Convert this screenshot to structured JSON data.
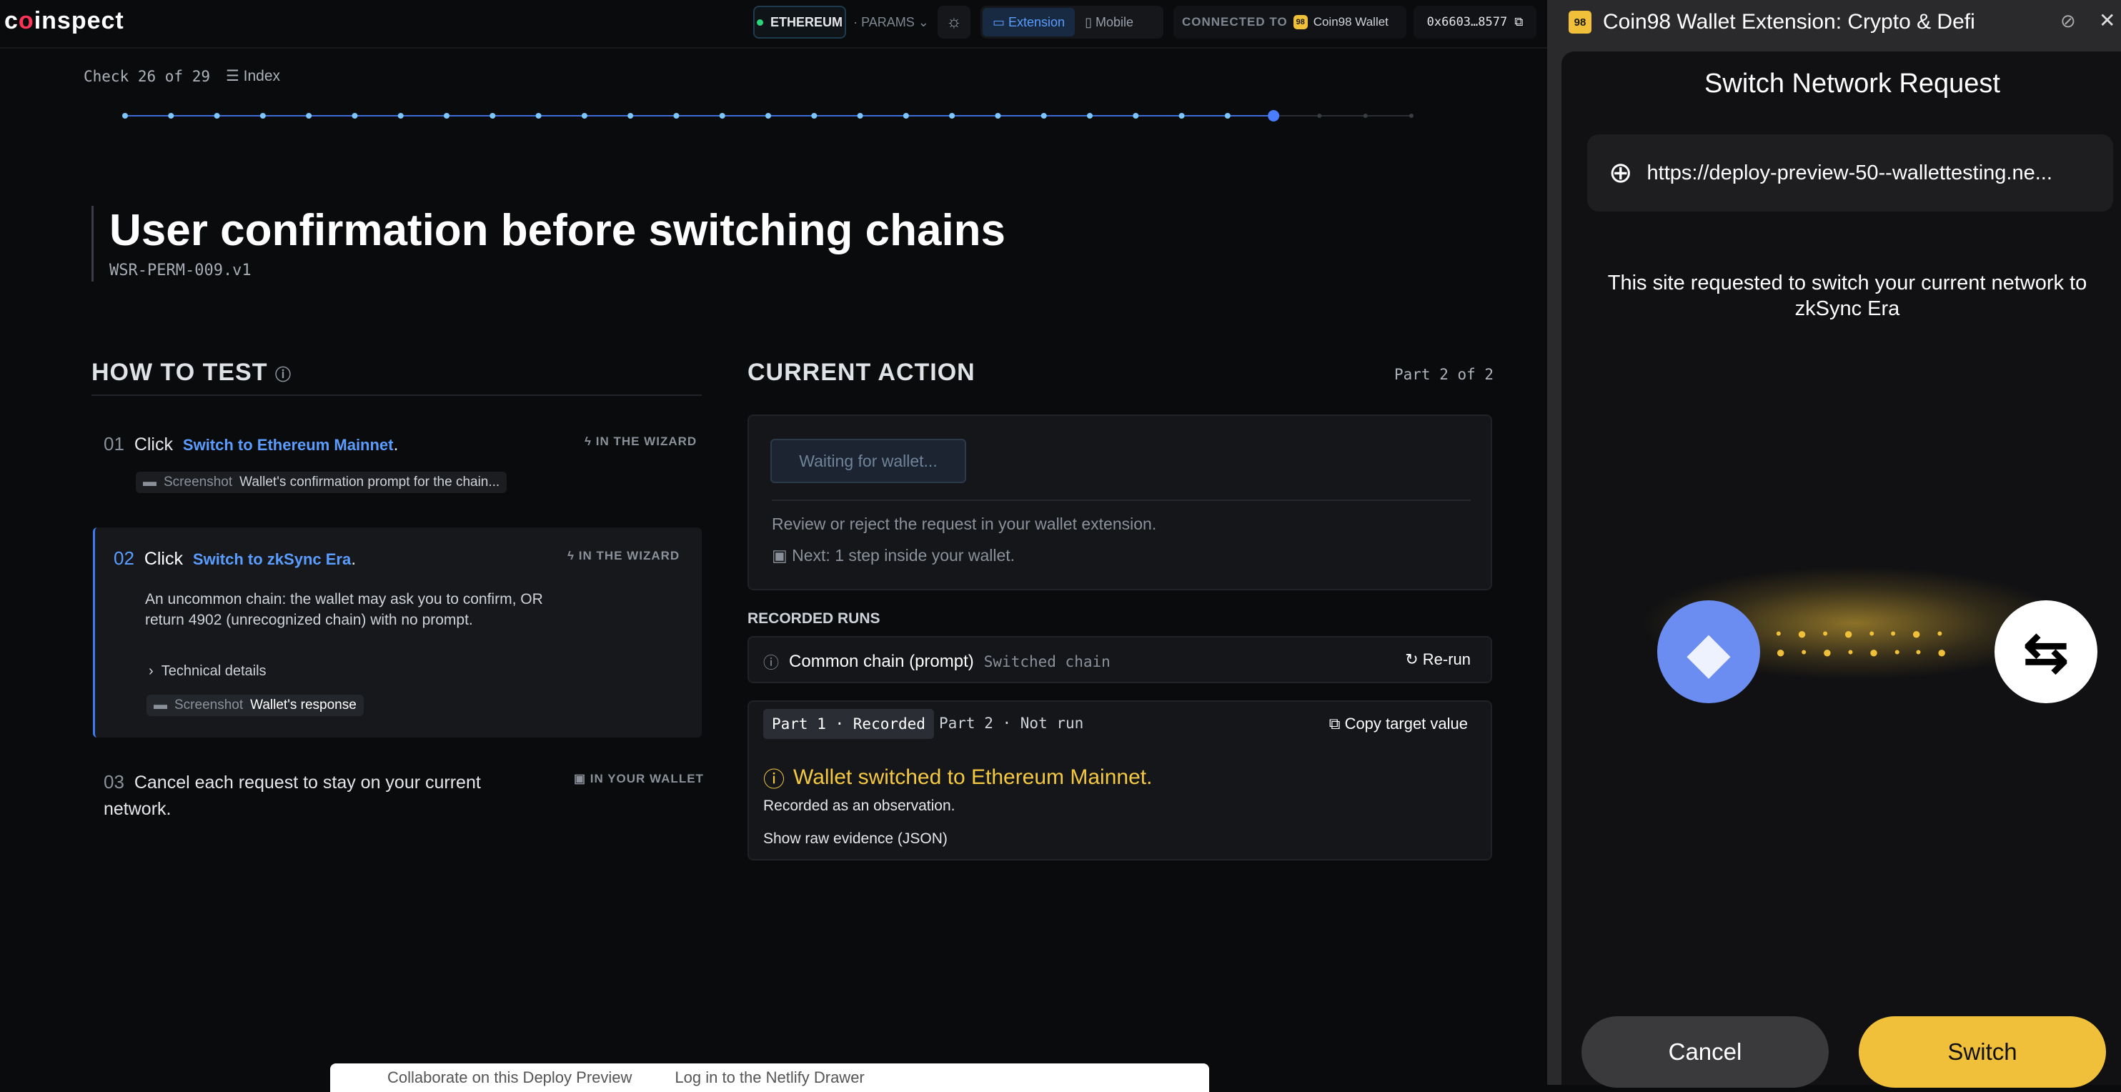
{
  "logo": {
    "pre": "c",
    "accent": "o",
    "post": "inspect"
  },
  "topbar": {
    "network": "ETHEREUM",
    "params": "PARAMS",
    "extension": "Extension",
    "mobile": "Mobile",
    "connected_label": "CONNECTED TO",
    "wallet": "Coin98 Wallet",
    "address": "0x6603…8577"
  },
  "check": {
    "label": "Check 26 of 29",
    "index": "Index",
    "current": 26,
    "total": 29
  },
  "test": {
    "title": "User confirmation before switching chains",
    "code": "WSR-PERM-009.v1"
  },
  "how_to_test": {
    "title": "HOW TO TEST",
    "steps": [
      {
        "num": "01",
        "verb": "Click",
        "link": "Switch to Ethereum Mainnet",
        "tag": "IN THE WIZARD",
        "shot_label": "Screenshot",
        "shot_value": "Wallet's confirmation prompt for the chain..."
      },
      {
        "num": "02",
        "verb": "Click",
        "link": "Switch to zkSync Era",
        "tag": "IN THE WIZARD",
        "desc": "An uncommon chain: the wallet may ask you to confirm, OR return 4902 (unrecognized chain) with no prompt.",
        "details": "Technical details",
        "shot_label": "Screenshot",
        "shot_value": "Wallet's response"
      },
      {
        "num": "03",
        "text": "Cancel each request to stay on your current network.",
        "tag": "IN YOUR WALLET"
      }
    ]
  },
  "current_action": {
    "title": "CURRENT ACTION",
    "part": "Part 2 of 2",
    "waiting": "Waiting for wallet...",
    "instruction": "Review or reject the request in your wallet extension.",
    "next": "Next: 1 step inside your wallet."
  },
  "recorded_runs": {
    "title": "RECORDED RUNS",
    "run_name": "Common chain (prompt)",
    "run_status": "Switched chain",
    "rerun": "Re-run",
    "part1": "Part 1 · Recorded",
    "part2": "Part 2 · Not run",
    "copy": "Copy target value",
    "result": "Wallet switched to Ethereum Mainnet.",
    "observation": "Recorded as an observation.",
    "raw": "Show raw evidence (JSON)"
  },
  "popup": {
    "app_title": "Coin98 Wallet Extension: Crypto & Defi",
    "icon_text": "98",
    "heading": "Switch Network Request",
    "url": "https://deploy-preview-50--wallettesting.ne...",
    "message": "This site requested to switch your current network to zkSync Era",
    "cancel": "Cancel",
    "switch": "Switch"
  },
  "toast": {
    "collab": "Collaborate on this Deploy Preview",
    "login": "Log in to the Netlify Drawer"
  },
  "colors": {
    "accent": "#5b9dff",
    "warning": "#f5c842",
    "switch": "#f0c03a"
  }
}
